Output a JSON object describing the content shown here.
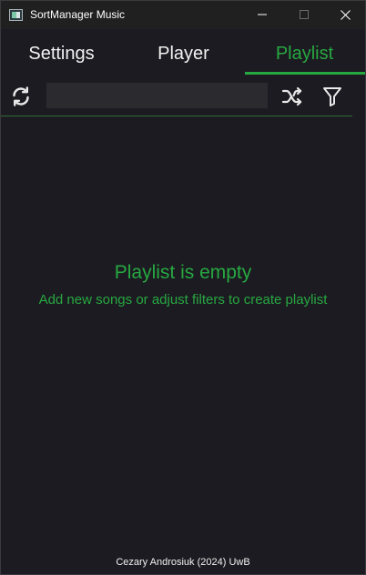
{
  "window": {
    "title": "SortManager Music",
    "controls": [
      "minimize-icon",
      "maximize-icon",
      "close-icon"
    ]
  },
  "tabs": [
    {
      "label": "Settings",
      "active": false
    },
    {
      "label": "Player",
      "active": false
    },
    {
      "label": "Playlist",
      "active": true
    }
  ],
  "toolbar": {
    "refresh_icon": "refresh-icon",
    "search": {
      "value": "",
      "placeholder": ""
    },
    "shuffle_icon": "shuffle-icon",
    "filter_icon": "filter-icon"
  },
  "empty_state": {
    "title": "Playlist is empty",
    "subtitle": "Add new songs or adjust filters to create playlist"
  },
  "footer": {
    "text": "Cezary Androsiuk (2024) UwB"
  },
  "colors": {
    "background": "#1c1b21",
    "titlebar": "#202020",
    "accent": "#27a841",
    "text": "#f2f2f2",
    "input_background": "#2a2a2f"
  }
}
